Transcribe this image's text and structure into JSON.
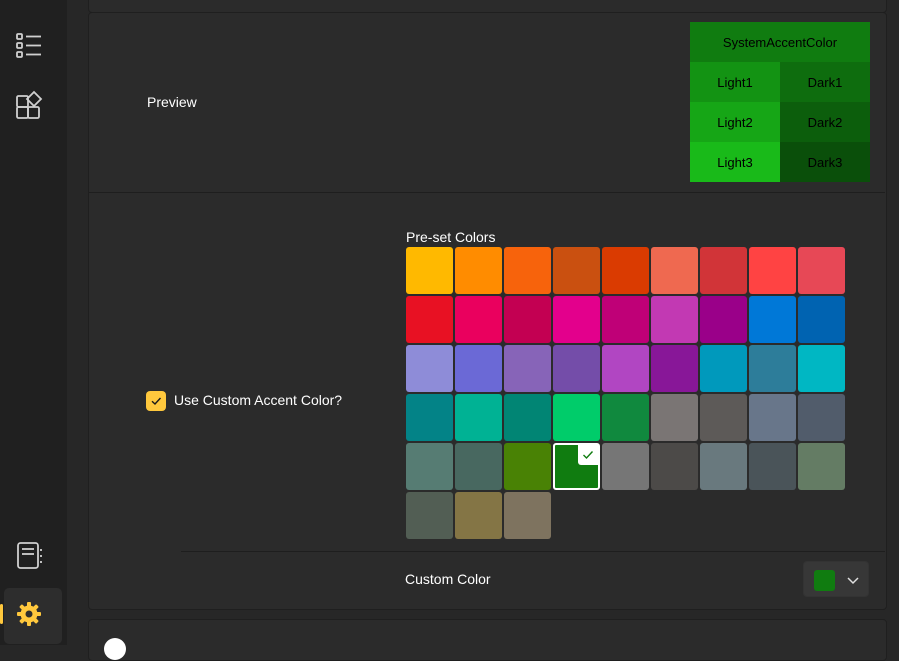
{
  "nav": {
    "items": [
      {
        "icon": "list-icon"
      },
      {
        "icon": "apps-add-icon"
      },
      {
        "icon": "notebook-icon"
      },
      {
        "icon": "settings-gear-icon",
        "selected": true
      }
    ],
    "accent": "#ffc83d"
  },
  "preview": {
    "label": "Preview",
    "system_accent_label": "SystemAccentColor",
    "light1": "Light1",
    "light2": "Light2",
    "light3": "Light3",
    "dark1": "Dark1",
    "dark2": "Dark2",
    "dark3": "Dark3",
    "colors": {
      "system": "#107c10",
      "light1": "#139313",
      "light2": "#16a616",
      "light3": "#19ba19",
      "dark1": "#0e6d0e",
      "dark2": "#0c5e0c",
      "dark3": "#0a4f0a"
    }
  },
  "custom_accent": {
    "checkbox_label": "Use Custom Accent Color?",
    "checked": true,
    "preset_title": "Pre-set Colors",
    "selected_index": 39,
    "swatches": [
      "#ffb900",
      "#ff8c00",
      "#f7630c",
      "#ca5010",
      "#da3b01",
      "#ef6950",
      "#d13438",
      "#ff4343",
      "#e74856",
      "#e81123",
      "#ea005e",
      "#c30052",
      "#e3008c",
      "#bf0077",
      "#c239b3",
      "#9a0089",
      "#0078d7",
      "#0063b1",
      "#8e8cd8",
      "#6b69d6",
      "#8764b8",
      "#744da9",
      "#b146c2",
      "#881798",
      "#0099bc",
      "#2d7d9a",
      "#00b7c3",
      "#038387",
      "#00b294",
      "#018574",
      "#00cc6a",
      "#10893e",
      "#7a7574",
      "#5d5a58",
      "#68768a",
      "#515c6b",
      "#567c73",
      "#486860",
      "#498205",
      "#107c10",
      "#767676",
      "#4c4a48",
      "#69797e",
      "#4a5459",
      "#647c64",
      "#525e54",
      "#847545",
      "#7e735f"
    ],
    "custom_color_label": "Custom Color",
    "custom_color_value": "#107c10"
  }
}
